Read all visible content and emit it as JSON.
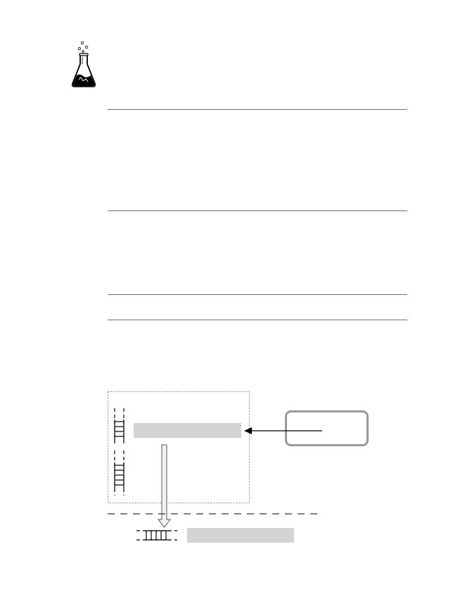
{
  "icons": {
    "flask": "erlenmeyer-flask-icon",
    "arrow_down": "arrow-down-icon",
    "arrow_left": "arrow-left-icon",
    "ladder": "ladder-icon"
  },
  "colors": {
    "rule": "#6f6f6f",
    "line": "#000000",
    "grey_bar": "#d4d4d4",
    "box_stroke": "#999999",
    "dotted": "#8a8a8a"
  }
}
